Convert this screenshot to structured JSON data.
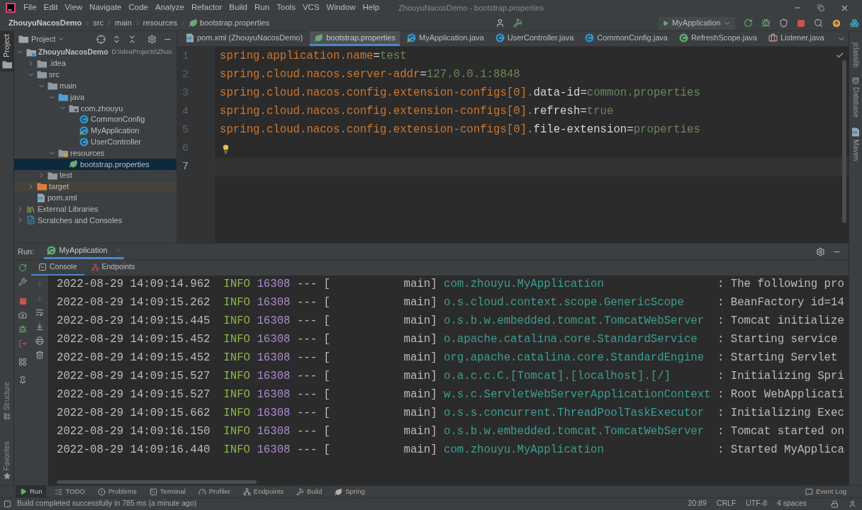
{
  "title_bar": {
    "menu": [
      "File",
      "Edit",
      "View",
      "Navigate",
      "Code",
      "Analyze",
      "Refactor",
      "Build",
      "Run",
      "Tools",
      "VCS",
      "Window",
      "Help"
    ],
    "title": "ZhouyuNacosDemo - bootstrap.properties"
  },
  "navigation_bar": {
    "breadcrumbs": [
      {
        "label": "ZhouyuNacosDemo",
        "kind": "project"
      },
      {
        "label": "src",
        "kind": "folder"
      },
      {
        "label": "main",
        "kind": "folder"
      },
      {
        "label": "resources",
        "kind": "folder"
      },
      {
        "label": "bootstrap.properties",
        "kind": "properties"
      }
    ],
    "run_configuration": "MyApplication"
  },
  "left_stripe": {
    "top": [
      {
        "label": "Project",
        "kind": "project",
        "selected": true
      }
    ],
    "bottom": [
      {
        "label": "Structure",
        "kind": "structure",
        "selected": false
      },
      {
        "label": "Favorites",
        "kind": "favorites",
        "selected": false
      }
    ]
  },
  "project_panel": {
    "title": "Project",
    "tree": [
      {
        "label": "ZhouyuNacosDemo",
        "location": "D:\\IdeaProjects\\Zhou",
        "kind": "project",
        "expanded": true,
        "selected": false,
        "children": [
          {
            "label": ".idea",
            "kind": "folder",
            "expanded": false,
            "selected": false
          },
          {
            "label": "src",
            "kind": "folder",
            "expanded": true,
            "selected": false,
            "children": [
              {
                "label": "main",
                "kind": "folder",
                "expanded": true,
                "selected": false,
                "children": [
                  {
                    "label": "java",
                    "kind": "source-folder",
                    "expanded": true,
                    "selected": false,
                    "children": [
                      {
                        "label": "com.zhouyu",
                        "kind": "package",
                        "expanded": true,
                        "selected": false,
                        "children": [
                          {
                            "label": "CommonConfig",
                            "kind": "class",
                            "selected": false
                          },
                          {
                            "label": "MyApplication",
                            "kind": "spring-class",
                            "selected": false
                          },
                          {
                            "label": "UserController",
                            "kind": "class",
                            "selected": false
                          }
                        ]
                      }
                    ]
                  },
                  {
                    "label": "resources",
                    "kind": "resources-folder",
                    "expanded": true,
                    "selected": false,
                    "children": [
                      {
                        "label": "bootstrap.properties",
                        "kind": "properties",
                        "selected": true
                      }
                    ]
                  }
                ]
              },
              {
                "label": "test",
                "kind": "folder",
                "expanded": false,
                "selected": false
              }
            ]
          },
          {
            "label": "target",
            "kind": "excluded-folder",
            "expanded": false,
            "selected": false
          },
          {
            "label": "pom.xml",
            "kind": "maven",
            "selected": false
          }
        ]
      },
      {
        "label": "External Libraries",
        "kind": "libraries",
        "expanded": false,
        "selected": false
      },
      {
        "label": "Scratches and Consoles",
        "kind": "scratches",
        "expanded": false,
        "selected": false
      }
    ]
  },
  "editor": {
    "tabs": [
      {
        "label": "pom.xml (ZhouyuNacosDemo)",
        "kind": "maven",
        "selected": false
      },
      {
        "label": "bootstrap.properties",
        "kind": "properties",
        "selected": true
      },
      {
        "label": "MyApplication.java",
        "kind": "spring-class",
        "selected": false
      },
      {
        "label": "UserController.java",
        "kind": "class",
        "selected": false
      },
      {
        "label": "CommonConfig.java",
        "kind": "class",
        "selected": false
      },
      {
        "label": "RefreshScope.java",
        "kind": "annotation",
        "selected": false
      },
      {
        "label": "Listener.java",
        "kind": "listener",
        "selected": false
      }
    ],
    "lines": [
      {
        "number": "1",
        "current": false,
        "bulb": false,
        "segments": [
          {
            "kind": "key",
            "text": "spring.application.name"
          },
          {
            "kind": "op",
            "text": "="
          },
          {
            "kind": "value",
            "text": "test"
          }
        ]
      },
      {
        "number": "2",
        "current": false,
        "bulb": false,
        "segments": [
          {
            "kind": "key",
            "text": "spring.cloud.nacos.server-addr"
          },
          {
            "kind": "op",
            "text": "="
          },
          {
            "kind": "value",
            "text": "127.0.0.1:8848"
          }
        ]
      },
      {
        "number": "3",
        "current": false,
        "bulb": false,
        "segments": [
          {
            "kind": "key",
            "text": "spring.cloud.nacos.config.extension-configs[0]."
          },
          {
            "kind": "key-part",
            "text": "data-id"
          },
          {
            "kind": "op",
            "text": "="
          },
          {
            "kind": "value",
            "text": "common.properties"
          }
        ]
      },
      {
        "number": "4",
        "current": false,
        "bulb": false,
        "segments": [
          {
            "kind": "key",
            "text": "spring.cloud.nacos.config.extension-configs[0]."
          },
          {
            "kind": "key-part",
            "text": "refresh"
          },
          {
            "kind": "op",
            "text": "="
          },
          {
            "kind": "value",
            "text": "true"
          }
        ]
      },
      {
        "number": "5",
        "current": false,
        "bulb": false,
        "segments": [
          {
            "kind": "key",
            "text": "spring.cloud.nacos.config.extension-configs[0]."
          },
          {
            "kind": "key-part",
            "text": "file-extension"
          },
          {
            "kind": "op",
            "text": "="
          },
          {
            "kind": "value",
            "text": "properties"
          }
        ]
      },
      {
        "number": "6",
        "current": false,
        "bulb": true
      },
      {
        "number": "7",
        "current": true,
        "bulb": false
      }
    ]
  },
  "right_stripe": [
    {
      "label": "jclasslib",
      "kind": "plain"
    },
    {
      "label": "Database",
      "kind": "database"
    },
    {
      "label": "Maven",
      "kind": "maven"
    }
  ],
  "run_panel": {
    "label": "Run:",
    "tabs": [
      {
        "label": "MyApplication",
        "selected": true
      }
    ],
    "subtabs": [
      {
        "label": "Console",
        "kind": "console",
        "selected": true
      },
      {
        "label": "Endpoints",
        "kind": "endpoints",
        "selected": false
      }
    ],
    "console": [
      {
        "timestamp": "2022-08-29 14:09:14.962",
        "level": "INFO",
        "kind": "info",
        "pid": "16308",
        "separator": "---",
        "thread_open": "[",
        "thread": "main]",
        "logger": "com.zhouyu.MyApplication",
        "message": ": The following pro"
      },
      {
        "timestamp": "2022-08-29 14:09:15.262",
        "level": "INFO",
        "kind": "info",
        "pid": "16308",
        "separator": "---",
        "thread_open": "[",
        "thread": "main]",
        "logger": "o.s.cloud.context.scope.GenericScope",
        "message": ": BeanFactory id=14"
      },
      {
        "timestamp": "2022-08-29 14:09:15.445",
        "level": "INFO",
        "kind": "info",
        "pid": "16308",
        "separator": "---",
        "thread_open": "[",
        "thread": "main]",
        "logger": "o.s.b.w.embedded.tomcat.TomcatWebServer",
        "message": ": Tomcat initialize"
      },
      {
        "timestamp": "2022-08-29 14:09:15.452",
        "level": "INFO",
        "kind": "info",
        "pid": "16308",
        "separator": "---",
        "thread_open": "[",
        "thread": "main]",
        "logger": "o.apache.catalina.core.StandardService",
        "message": ": Starting service"
      },
      {
        "timestamp": "2022-08-29 14:09:15.452",
        "level": "INFO",
        "kind": "info",
        "pid": "16308",
        "separator": "---",
        "thread_open": "[",
        "thread": "main]",
        "logger": "org.apache.catalina.core.StandardEngine",
        "message": ": Starting Servlet"
      },
      {
        "timestamp": "2022-08-29 14:09:15.527",
        "level": "INFO",
        "kind": "info",
        "pid": "16308",
        "separator": "---",
        "thread_open": "[",
        "thread": "main]",
        "logger": "o.a.c.c.C.[Tomcat].[localhost].[/]",
        "message": ": Initializing Spri"
      },
      {
        "timestamp": "2022-08-29 14:09:15.527",
        "level": "INFO",
        "kind": "info",
        "pid": "16308",
        "separator": "---",
        "thread_open": "[",
        "thread": "main]",
        "logger": "w.s.c.ServletWebServerApplicationContext",
        "message": ": Root WebApplicati"
      },
      {
        "timestamp": "2022-08-29 14:09:15.662",
        "level": "INFO",
        "kind": "info",
        "pid": "16308",
        "separator": "---",
        "thread_open": "[",
        "thread": "main]",
        "logger": "o.s.s.concurrent.ThreadPoolTaskExecutor",
        "message": ": Initializing Exec"
      },
      {
        "timestamp": "2022-08-29 14:09:16.150",
        "level": "INFO",
        "kind": "info",
        "pid": "16308",
        "separator": "---",
        "thread_open": "[",
        "thread": "main]",
        "logger": "o.s.b.w.embedded.tomcat.TomcatWebServer",
        "message": ": Tomcat started on"
      },
      {
        "timestamp": "2022-08-29 14:09:16.440",
        "level": "INFO",
        "kind": "info",
        "pid": "16308",
        "separator": "---",
        "thread_open": "[",
        "thread": "main]",
        "logger": "com.zhouyu.MyApplication",
        "message": ": Started MyApplica"
      }
    ]
  },
  "tool_window_bar": {
    "items": [
      {
        "label": "Run",
        "kind": "run",
        "selected": true
      },
      {
        "label": "TODO",
        "kind": "todo",
        "selected": false
      },
      {
        "label": "Problems",
        "kind": "problems",
        "selected": false
      },
      {
        "label": "Terminal",
        "kind": "terminal",
        "selected": false
      },
      {
        "label": "Profiler",
        "kind": "profiler",
        "selected": false
      },
      {
        "label": "Endpoints",
        "kind": "endpoints",
        "selected": false
      },
      {
        "label": "Build",
        "kind": "build",
        "selected": false
      },
      {
        "label": "Spring",
        "kind": "spring",
        "selected": false
      }
    ],
    "event_log": "Event Log"
  },
  "status_bar": {
    "message": "Build completed successfully in 785 ms (a minute ago)",
    "items": [
      "20:89",
      "CRLF",
      "UTF-8",
      "4 spaces"
    ]
  }
}
